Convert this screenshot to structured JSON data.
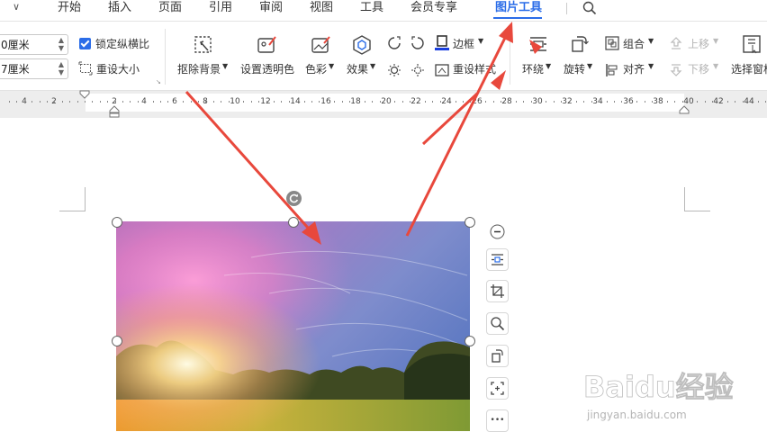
{
  "menubar": {
    "chevron": "∨",
    "tabs": [
      {
        "label": "开始",
        "active": false
      },
      {
        "label": "插入",
        "active": false
      },
      {
        "label": "页面",
        "active": false
      },
      {
        "label": "引用",
        "active": false
      },
      {
        "label": "审阅",
        "active": false
      },
      {
        "label": "视图",
        "active": false
      },
      {
        "label": "工具",
        "active": false
      },
      {
        "label": "会员专享",
        "active": false
      },
      {
        "label": "图片工具",
        "active": true
      }
    ],
    "search_icon": "search-icon"
  },
  "ribbon": {
    "size": {
      "width_value": "0厘米",
      "height_value": "7厘米",
      "lock_ratio_label": "锁定纵横比",
      "lock_ratio_checked": true,
      "reset_size_label": "重设大小"
    },
    "remove_bg_label": "抠除背景",
    "transparent_label": "设置透明色",
    "color_label": "色彩",
    "effects_label": "效果",
    "border_label": "边框",
    "reset_style_label": "重设样式",
    "wrap_label": "环绕",
    "rotate_label": "旋转",
    "group_label": "组合",
    "align_label": "对齐",
    "up_label": "上移",
    "down_label": "下移",
    "select_pane_label": "选择窗格",
    "accent_color": "#2b6de8"
  },
  "ruler": {
    "labels": [
      "4",
      "2",
      "2",
      "4",
      "6",
      "8",
      "10",
      "12",
      "14",
      "16",
      "18",
      "20",
      "22",
      "24",
      "26",
      "28",
      "30",
      "32",
      "34",
      "36",
      "38",
      "40",
      "42",
      "44"
    ]
  },
  "image_tools": {
    "buttons": [
      "minus-icon",
      "wrap-text-icon",
      "crop-icon",
      "zoom-icon",
      "rotate-icon",
      "frame-select-icon",
      "more-icon"
    ],
    "more_label": "•••"
  },
  "watermark": {
    "brand": "Baidu经验",
    "url": "jingyan.baidu.com"
  },
  "colors": {
    "arrow": "#e8483c",
    "ribbon_bg": "#ffffff",
    "ruler_bg": "#ededed"
  }
}
